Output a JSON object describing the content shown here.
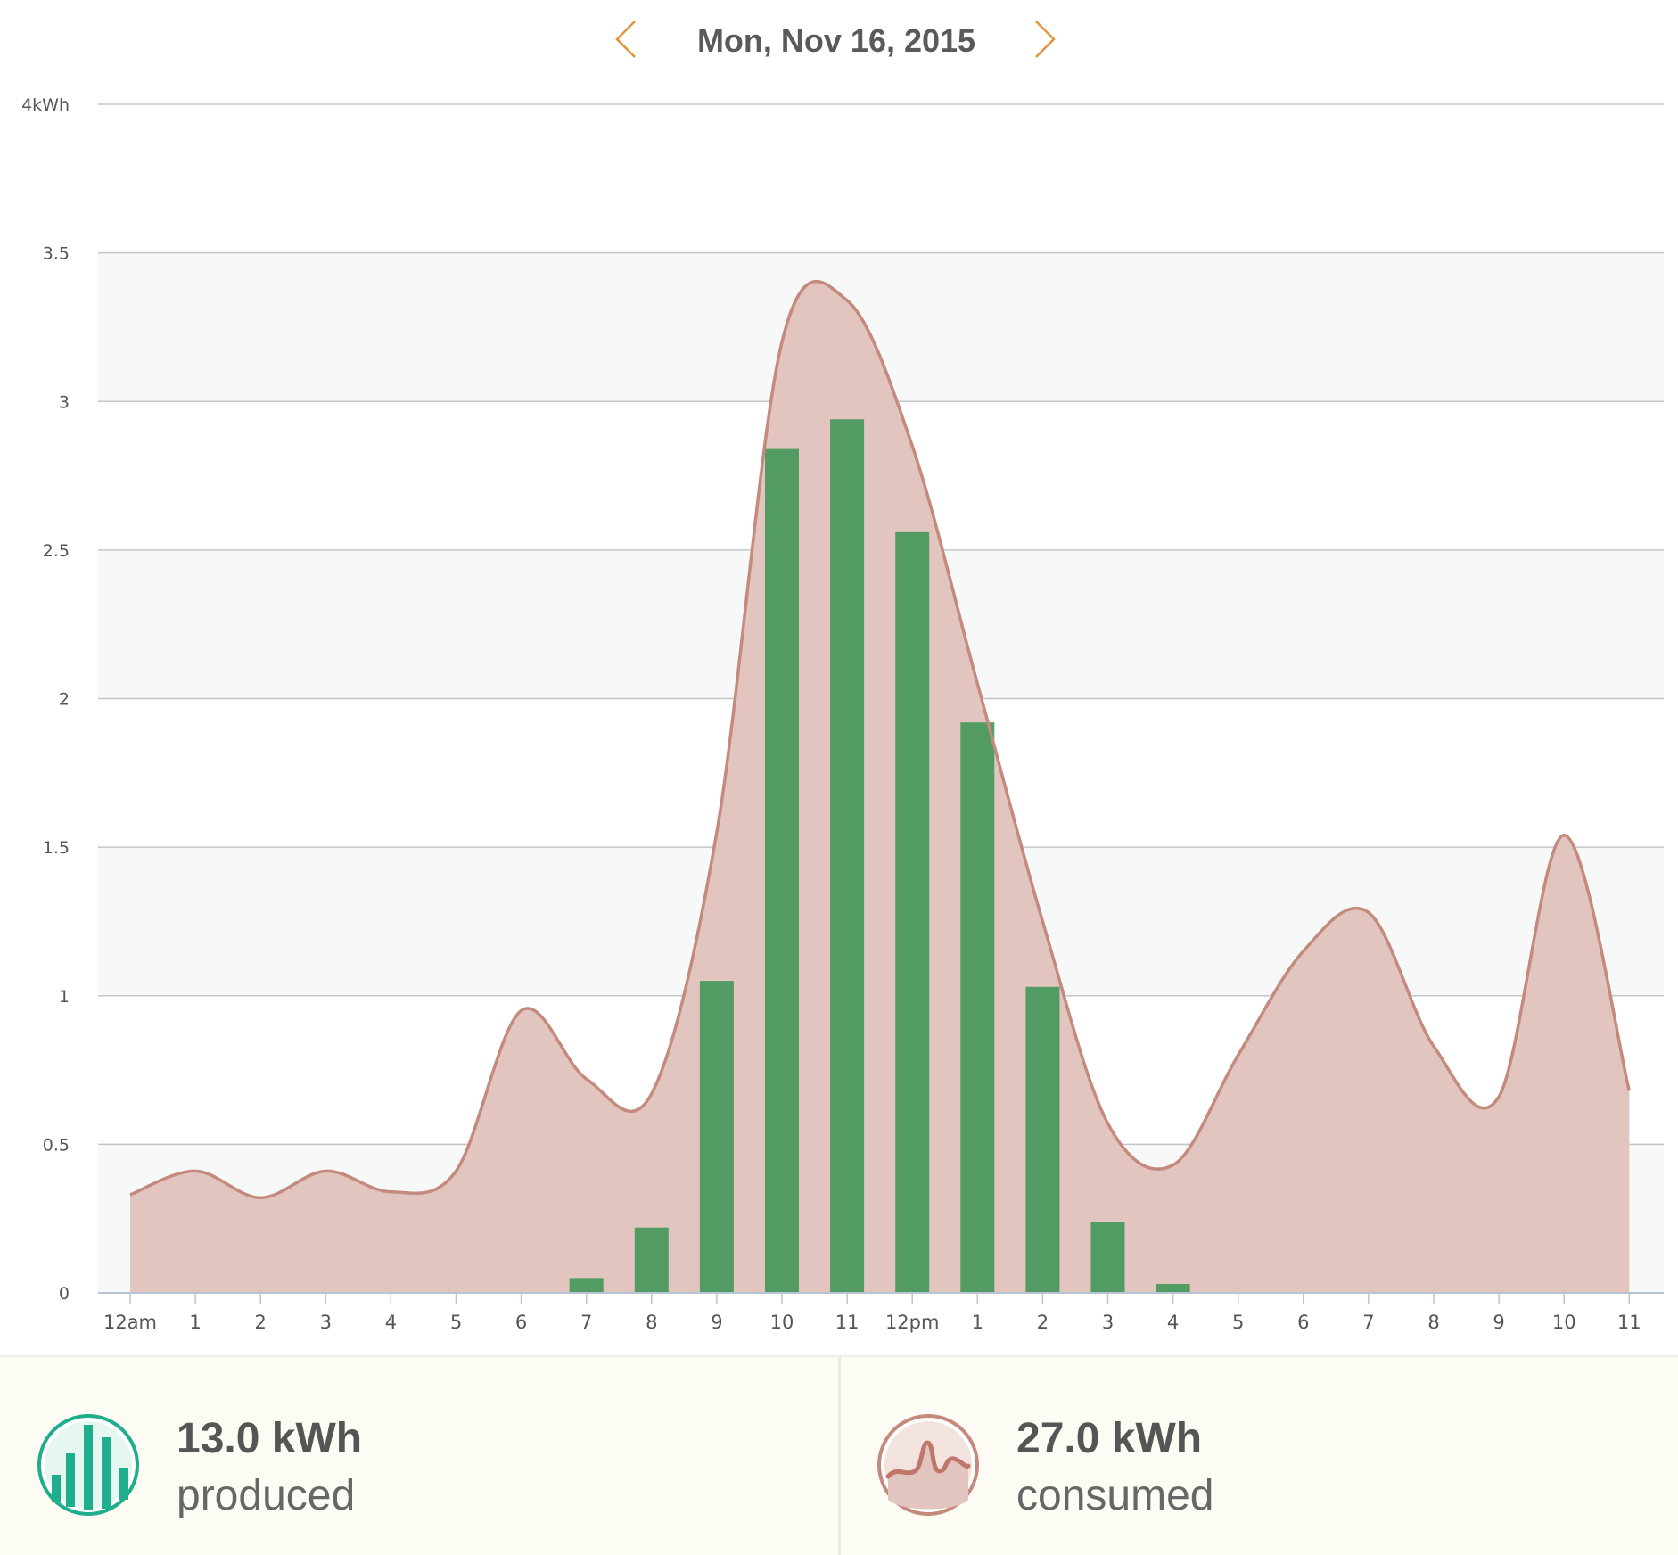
{
  "header": {
    "date": "Mon, Nov 16, 2015",
    "prev_icon": "chevron-left-icon",
    "next_icon": "chevron-right-icon",
    "accent_color": "#e8923a"
  },
  "chart_data": {
    "type": "bar",
    "title": "",
    "xlabel": "",
    "ylabel": "",
    "y_unit": "kWh",
    "ylim": [
      0,
      4
    ],
    "y_ticks": [
      "0",
      "0.5",
      "1",
      "1.5",
      "2",
      "2.5",
      "3",
      "3.5",
      "4kWh"
    ],
    "grid": true,
    "categories": [
      "12am",
      "1",
      "2",
      "3",
      "4",
      "5",
      "6",
      "7",
      "8",
      "9",
      "10",
      "11",
      "12pm",
      "1",
      "2",
      "3",
      "4",
      "5",
      "6",
      "7",
      "8",
      "9",
      "10",
      "11"
    ],
    "series": [
      {
        "kind": "bar",
        "color": "#4a9a5e",
        "values": [
          0,
          0,
          0,
          0,
          0,
          0,
          0,
          0.05,
          0.22,
          1.05,
          2.84,
          2.94,
          2.56,
          1.92,
          1.03,
          0.24,
          0.03,
          0,
          0,
          0,
          0,
          0,
          0,
          0
        ]
      },
      {
        "kind": "area",
        "color": "#c48a7e",
        "fill": "#e2c5bf",
        "values": [
          0.33,
          0.41,
          0.32,
          0.41,
          0.34,
          0.41,
          0.95,
          0.72,
          0.67,
          1.55,
          3.2,
          3.34,
          2.85,
          2.05,
          1.25,
          0.57,
          0.43,
          0.8,
          1.15,
          1.28,
          0.83,
          0.66,
          1.54,
          0.68
        ]
      }
    ]
  },
  "summary": {
    "produced": {
      "value": "13.0 kWh",
      "label": "produced",
      "icon": "production-bars-icon",
      "color": "#1fae8c"
    },
    "consumed": {
      "value": "27.0 kWh",
      "label": "consumed",
      "icon": "consumption-wave-icon",
      "color": "#c48a7e"
    }
  }
}
